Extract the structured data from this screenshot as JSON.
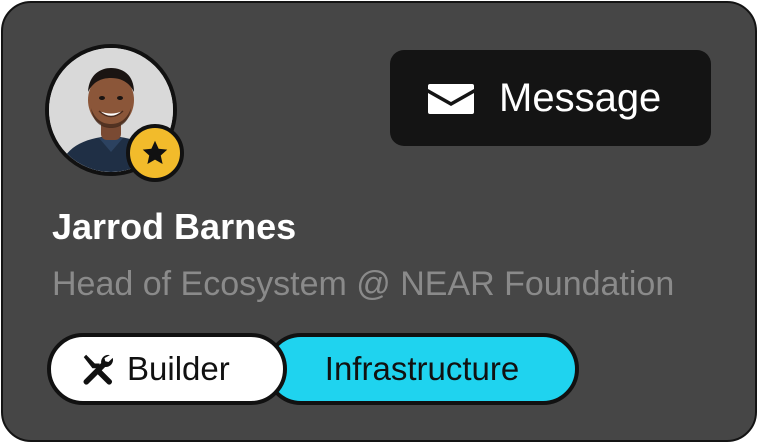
{
  "profile": {
    "name": "Jarrod Barnes",
    "title": "Head of Ecosystem @ NEAR Foundation",
    "avatar_icon": "user-photo",
    "badge_icon": "star-icon"
  },
  "actions": {
    "message_label": "Message",
    "message_icon": "envelope-icon"
  },
  "tags": [
    {
      "label": "Builder",
      "icon": "tools-icon",
      "color": "#ffffff"
    },
    {
      "label": "Infrastructure",
      "color": "#1fd3ef"
    }
  ],
  "colors": {
    "card_bg": "#464646",
    "button_bg": "#141414",
    "badge": "#f2bb2b",
    "accent": "#1fd3ef",
    "title_text": "#8a8a8a"
  }
}
